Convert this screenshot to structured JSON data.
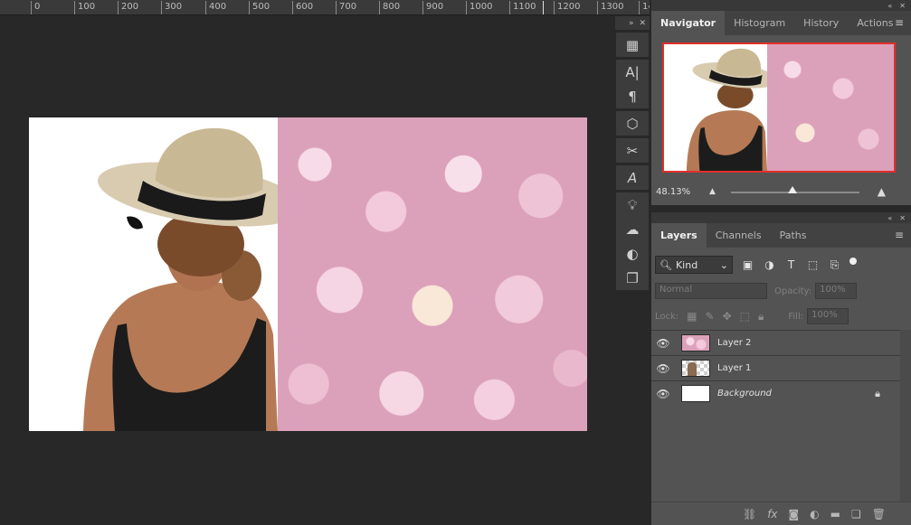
{
  "ruler": {
    "ticks": [
      "0",
      "100",
      "200",
      "300",
      "400",
      "500",
      "600",
      "700",
      "800",
      "900",
      "1000",
      "1100",
      "1200",
      "1300",
      "14"
    ]
  },
  "navigator_panel": {
    "tabs": [
      {
        "label": "Navigator",
        "active": true
      },
      {
        "label": "Histogram",
        "active": false
      },
      {
        "label": "History",
        "active": false
      },
      {
        "label": "Actions",
        "active": false
      }
    ],
    "zoom_text": "48.13%",
    "zoom_fraction": 0.48
  },
  "layers_panel": {
    "tabs": [
      {
        "label": "Layers",
        "active": true
      },
      {
        "label": "Channels",
        "active": false
      },
      {
        "label": "Paths",
        "active": false
      }
    ],
    "filter_kind": "Kind",
    "blend_mode": "Normal",
    "opacity_label": "Opacity:",
    "opacity_value": "100%",
    "lock_label": "Lock:",
    "fill_label": "Fill:",
    "fill_value": "100%",
    "layers": [
      {
        "name": "Layer 2",
        "thumb": "flowers",
        "italic": false,
        "locked": false
      },
      {
        "name": "Layer 1",
        "thumb": "woman",
        "italic": false,
        "locked": false
      },
      {
        "name": "Background",
        "thumb": "white",
        "italic": true,
        "locked": true
      }
    ]
  },
  "tools": [
    "grid-icon",
    "character-icon",
    "paragraph-icon",
    "3d-cube-icon",
    "tool-presets-icon",
    "glyphs-icon",
    "lightbulb-icon",
    "libraries-icon",
    "adjustments-icon",
    "layer-comps-icon"
  ],
  "colors": {
    "accent_red": "#e0302a",
    "panel_bg": "#535353",
    "app_bg": "#282828"
  }
}
